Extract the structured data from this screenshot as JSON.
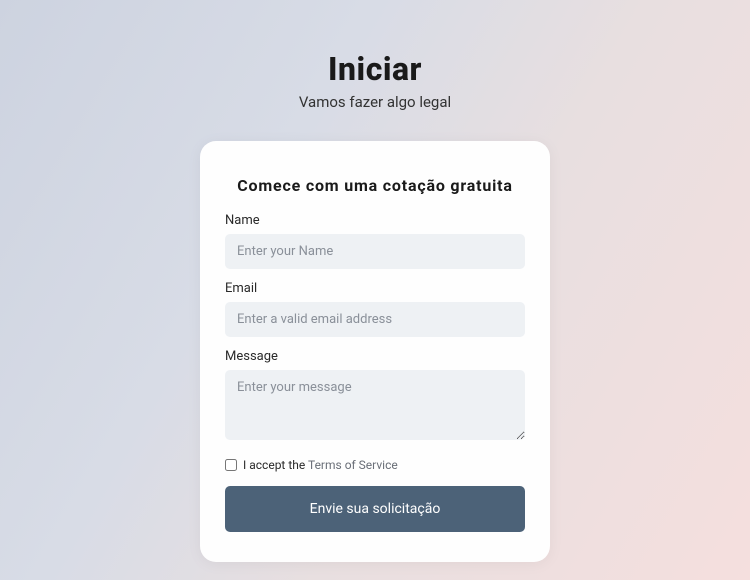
{
  "header": {
    "title": "Iniciar",
    "subtitle": "Vamos fazer algo legal"
  },
  "form": {
    "title": "Comece com uma cotação gratuita",
    "name": {
      "label": "Name",
      "placeholder": "Enter your Name"
    },
    "email": {
      "label": "Email",
      "placeholder": "Enter a valid email address"
    },
    "message": {
      "label": "Message",
      "placeholder": "Enter your message"
    },
    "terms": {
      "prefix": "I accept the ",
      "link": "Terms of Service"
    },
    "submit": "Envie sua solicitação"
  }
}
